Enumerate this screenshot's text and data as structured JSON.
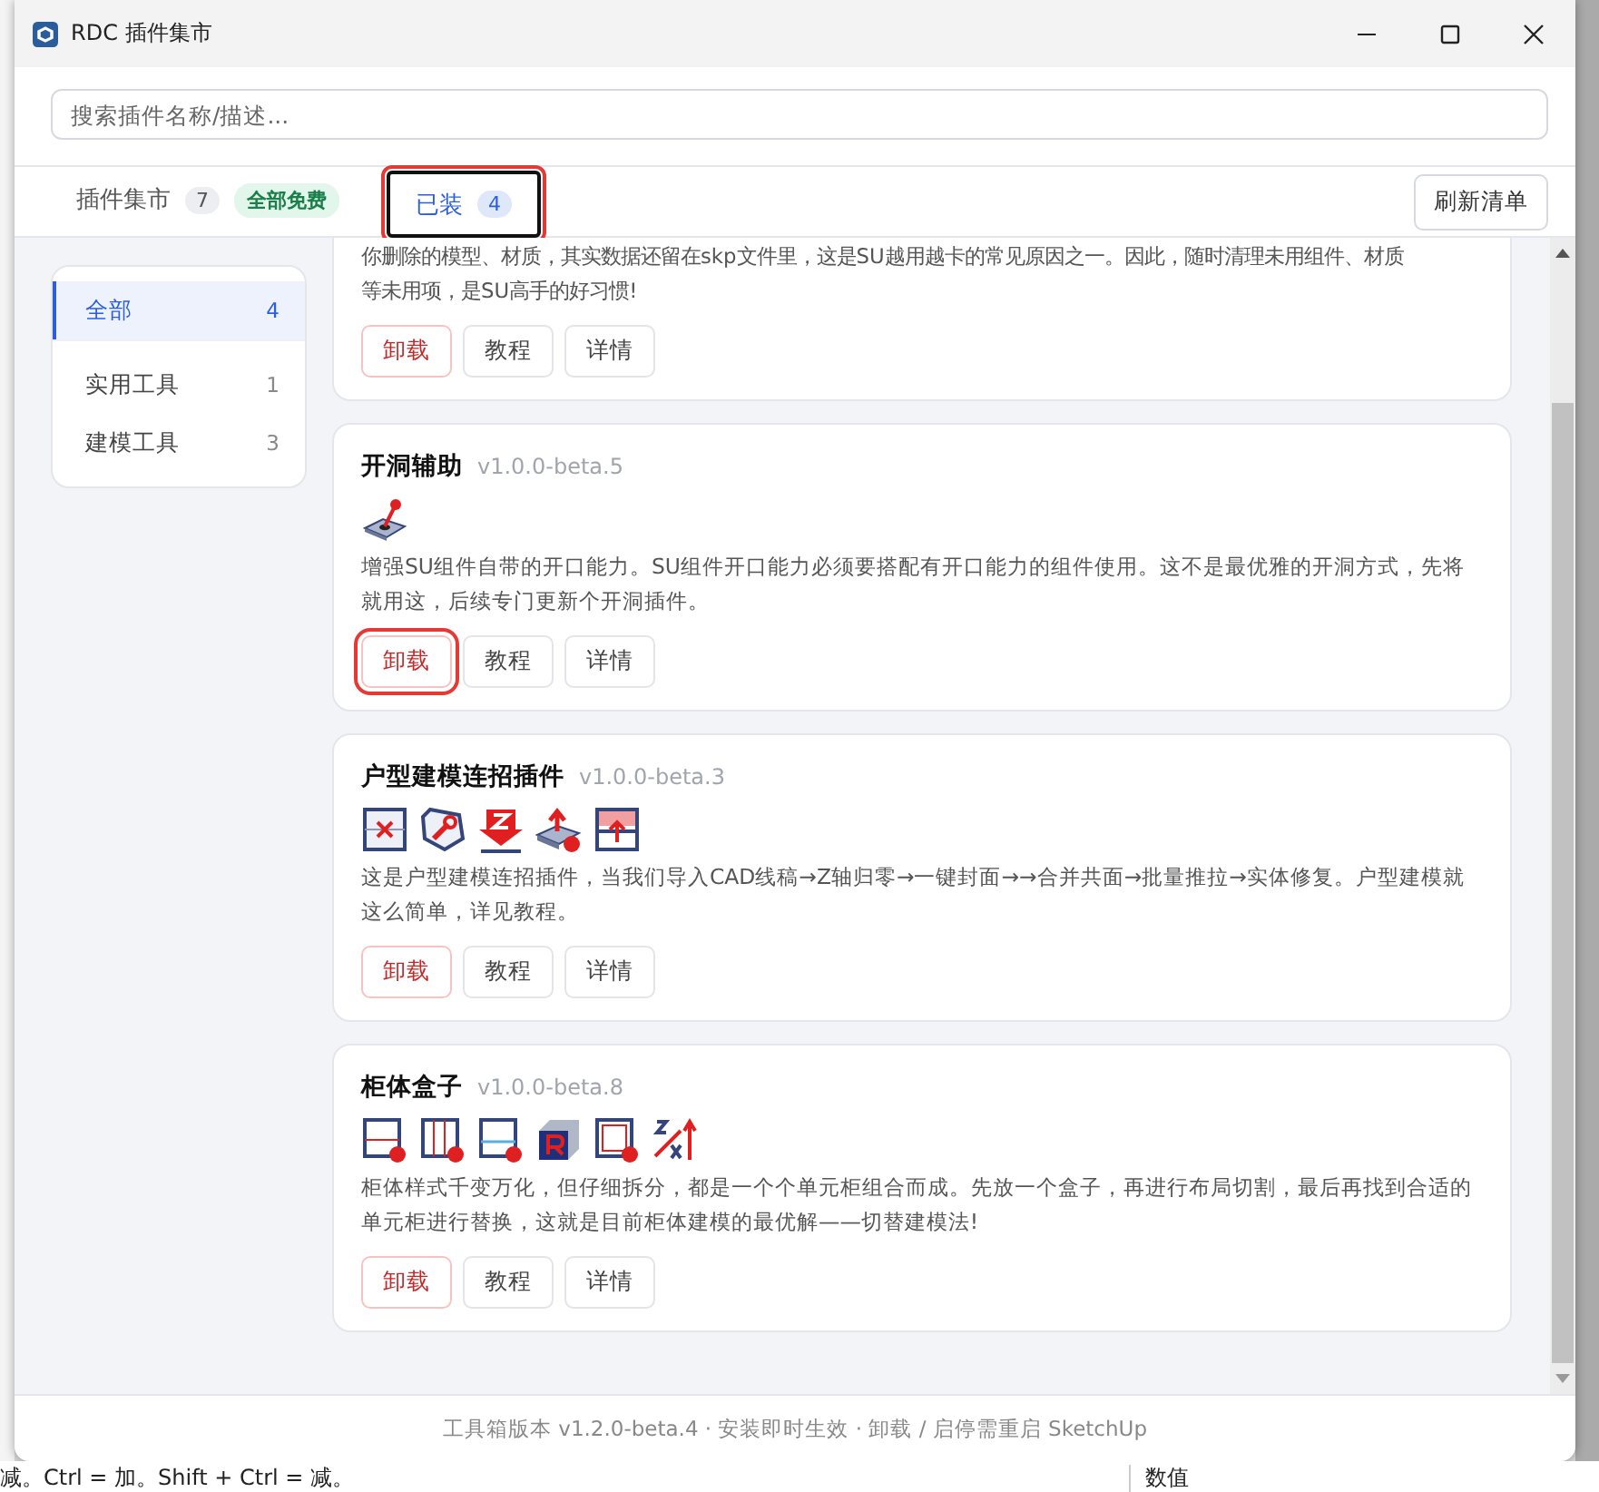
{
  "window": {
    "title": "RDC 插件集市"
  },
  "search": {
    "placeholder": "搜索插件名称/描述..."
  },
  "tabs": [
    {
      "label": "插件集市",
      "count": "7",
      "badge": "全部免费",
      "selected": false,
      "highlighted": false
    },
    {
      "label": "已装",
      "count": "4",
      "selected": true,
      "highlighted": true
    }
  ],
  "refresh_button": "刷新清单",
  "sidebar": {
    "items": [
      {
        "label": "全部",
        "count": "4",
        "selected": true
      },
      {
        "label": "实用工具",
        "count": "1",
        "selected": false
      },
      {
        "label": "建模工具",
        "count": "3",
        "selected": false
      }
    ]
  },
  "plugins": [
    {
      "description_lines": [
        "你删除的模型、材质，其实数据还留在skp文件里，这是SU越用越卡的常见原因之一。因此，随时清理未用组件、材质",
        "等未用项，是SU高手的好习惯!"
      ],
      "buttons": [
        {
          "label": "卸载",
          "kind": "danger",
          "highlighted": false
        },
        {
          "label": "教程",
          "kind": "plain",
          "highlighted": false
        },
        {
          "label": "详情",
          "kind": "plain",
          "highlighted": false
        }
      ]
    },
    {
      "name": "开洞辅助",
      "version": "v1.0.0-beta.5",
      "kind": "hole",
      "description": "增强SU组件自带的开口能力。SU组件开口能力必须要搭配有开口能力的组件使用。这不是最优雅的开洞方式，先将就用这，后续专门更新个开洞插件。",
      "buttons": [
        {
          "label": "卸载",
          "kind": "danger",
          "highlighted": true
        },
        {
          "label": "教程",
          "kind": "plain",
          "highlighted": false
        },
        {
          "label": "详情",
          "kind": "plain",
          "highlighted": false
        }
      ]
    },
    {
      "name": "户型建模连招插件",
      "version": "v1.0.0-beta.3",
      "kind": "floorplan",
      "description": "这是户型建模连招插件，当我们导入CAD线稿→Z轴归零→一键封面→→合并共面→批量推拉→实体修复。户型建模就这么简单，详见教程。",
      "buttons": [
        {
          "label": "卸载",
          "kind": "danger",
          "highlighted": false
        },
        {
          "label": "教程",
          "kind": "plain",
          "highlighted": false
        },
        {
          "label": "详情",
          "kind": "plain",
          "highlighted": false
        }
      ]
    },
    {
      "name": "柜体盒子",
      "version": "v1.0.0-beta.8",
      "kind": "cabinet",
      "description": "柜体样式千变万化，但仔细拆分，都是一个个单元柜组合而成。先放一个盒子，再进行布局切割，最后再找到合适的单元柜进行替换，这就是目前柜体建模的最优解——切替建模法!",
      "buttons": [
        {
          "label": "卸载",
          "kind": "danger",
          "highlighted": false
        },
        {
          "label": "教程",
          "kind": "plain",
          "highlighted": false
        },
        {
          "label": "详情",
          "kind": "plain",
          "highlighted": false
        }
      ]
    }
  ],
  "footer": "工具箱版本 v1.2.0-beta.4 · 安装即时生效 · 卸载 / 启停需重启 SketchUp",
  "background_app": {
    "status_text": "减。Ctrl = 加。Shift + Ctrl = 减。",
    "panel_label": "数值"
  }
}
